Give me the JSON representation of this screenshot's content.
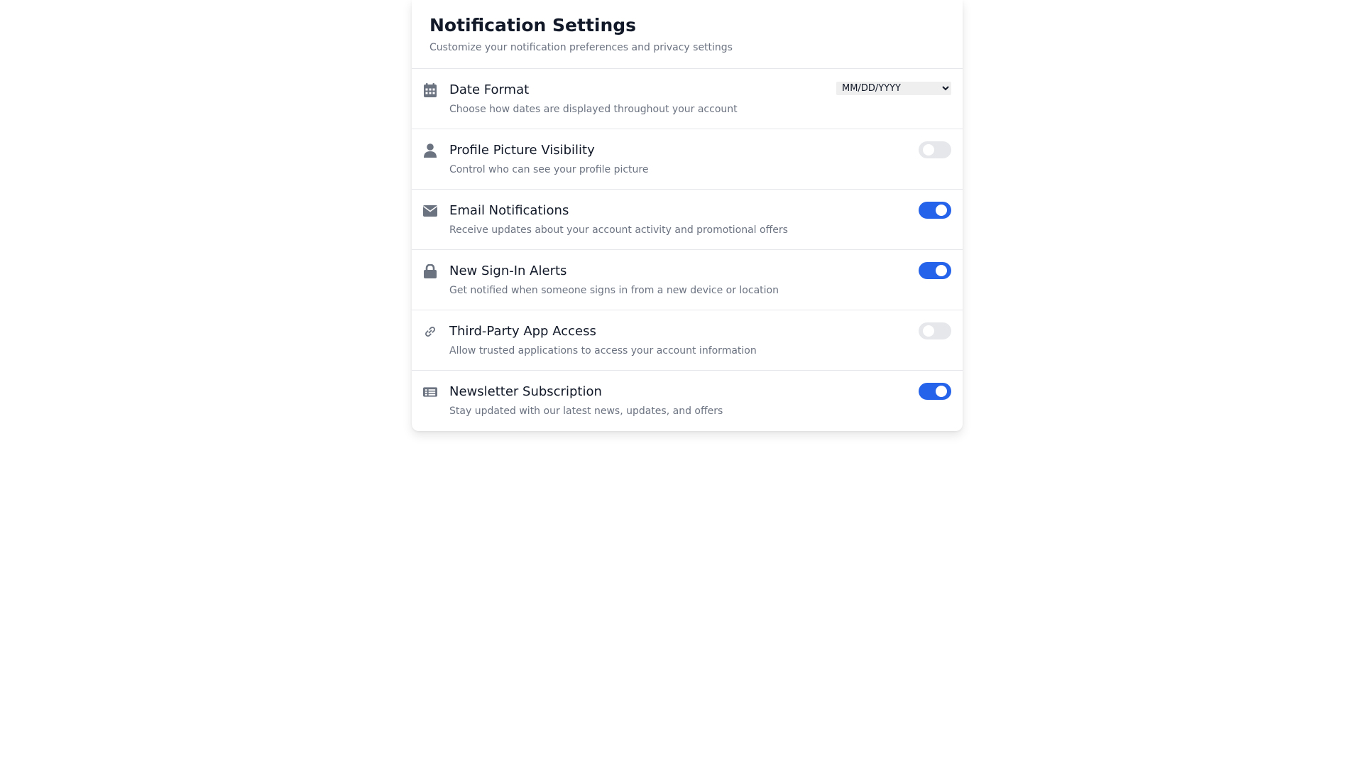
{
  "header": {
    "title": "Notification Settings",
    "subtitle": "Customize your notification preferences and privacy settings"
  },
  "settings": [
    {
      "id": "date-format",
      "icon": "calendar-icon",
      "title": "Date Format",
      "description": "Choose how dates are displayed throughout your account",
      "control": "select",
      "value": "MM/DD/YYYY"
    },
    {
      "id": "profile-picture-visibility",
      "icon": "user-icon",
      "title": "Profile Picture Visibility",
      "description": "Control who can see your profile picture",
      "control": "toggle",
      "enabled": false
    },
    {
      "id": "email-notifications",
      "icon": "envelope-icon",
      "title": "Email Notifications",
      "description": "Receive updates about your account activity and promotional offers",
      "control": "toggle",
      "enabled": true
    },
    {
      "id": "new-sign-in-alerts",
      "icon": "lock-icon",
      "title": "New Sign-In Alerts",
      "description": "Get notified when someone signs in from a new device or location",
      "control": "toggle",
      "enabled": true
    },
    {
      "id": "third-party-app-access",
      "icon": "link-icon",
      "title": "Third-Party App Access",
      "description": "Allow trusted applications to access your account information",
      "control": "toggle",
      "enabled": false
    },
    {
      "id": "newsletter-subscription",
      "icon": "newspaper-icon",
      "title": "Newsletter Subscription",
      "description": "Stay updated with our latest news, updates, and offers",
      "control": "toggle",
      "enabled": true
    }
  ],
  "colors": {
    "accent": "#2563eb",
    "toggle_off": "#e5e7eb",
    "icon": "#6b7280",
    "title": "#111827",
    "muted": "#6b7280"
  }
}
